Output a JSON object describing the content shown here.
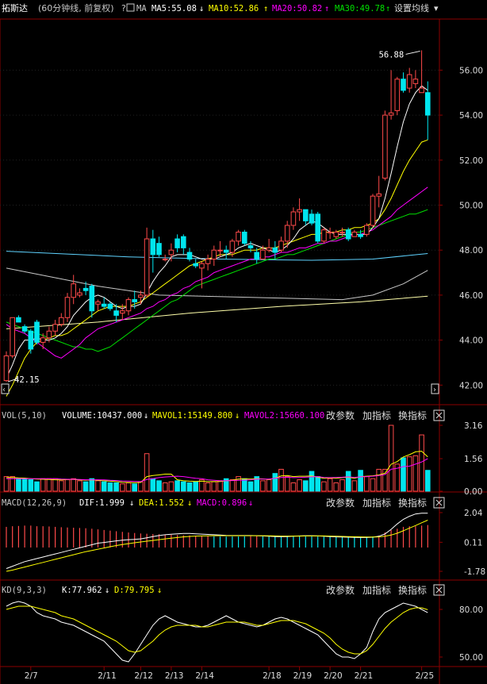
{
  "colors": {
    "up": "#ff4a4a",
    "down": "#00e5ee",
    "frame": "#8b0000",
    "ma5": "#ffffff",
    "ma10": "#ffff00",
    "ma20": "#ff00ff",
    "ma30": "#00e000",
    "extra1": "#5fd3ff",
    "extra2": "#c8c8c8",
    "extra3": "#ffffaa",
    "label": "#c8c8c8",
    "vol": "#ffffff",
    "mavol1": "#ffff00",
    "mavol2": "#ff00ff",
    "dif": "#ffffff",
    "dea": "#ffff00",
    "macd": "#ff00ff",
    "k": "#ffffff",
    "d": "#ffff00"
  },
  "header": {
    "title": "拓斯达",
    "subtitle": "(60分钟线, 前复权)",
    "ma_label": "MA",
    "ma5": "MA5:55.08",
    "ma10": "MA10:52.86",
    "ma20": "MA20:50.82",
    "ma30": "MA30:49.78",
    "settings": "设置均线",
    "arrow_down": "↓",
    "arrow_up": "↑",
    "dropdown": "▾"
  },
  "vol_header": {
    "name": "VOL(5,10)",
    "volume": "VOLUME:10437.000",
    "mavol1": "MAVOL1:15149.800",
    "mavol2": "MAVOL2:15660.100",
    "arrow_down": "↓"
  },
  "macd_header": {
    "name": "MACD(12,26,9)",
    "dif": "DIF:1.999",
    "dea": "DEA:1.552",
    "macd": "MACD:0.896",
    "arrow_down": "↓"
  },
  "kd_header": {
    "name": "KD(9,3,3)",
    "k": "K:77.962",
    "d": "D:79.795",
    "arrow_down": "↓"
  },
  "buttons": {
    "change": "改参数",
    "add": "加指标",
    "swap": "换指标"
  },
  "icons": {
    "close": "close-icon",
    "checkbox": "checkbox-icon",
    "help": "help-icon"
  },
  "chart_data": {
    "type": "candlestick",
    "title": "拓斯达",
    "price_ticks": [
      "56.00",
      "54.00",
      "52.00",
      "50.00",
      "48.00",
      "46.00",
      "44.00",
      "42.00"
    ],
    "price_ylim": [
      41.2,
      58.2
    ],
    "high_label": "56.88",
    "low_label": "42.15",
    "x_labels": [
      "2/7",
      "2/11",
      "2/12",
      "2/13",
      "2/14",
      "2/18",
      "2/19",
      "2/20",
      "2/21",
      "2/25"
    ],
    "candles": [
      {
        "o": 42.2,
        "h": 43.5,
        "l": 42.15,
        "c": 43.3
      },
      {
        "o": 43.3,
        "h": 44.3,
        "l": 43.2,
        "c": 45.0
      },
      {
        "o": 45.0,
        "h": 45.1,
        "l": 44.8,
        "c": 44.8
      },
      {
        "o": 44.6,
        "h": 44.7,
        "l": 44.3,
        "c": 44.4
      },
      {
        "o": 44.4,
        "h": 44.5,
        "l": 43.4,
        "c": 43.6
      },
      {
        "o": 44.8,
        "h": 44.9,
        "l": 43.8,
        "c": 43.9
      },
      {
        "o": 43.9,
        "h": 44.3,
        "l": 43.6,
        "c": 44.1
      },
      {
        "o": 44.1,
        "h": 44.6,
        "l": 43.9,
        "c": 44.4
      },
      {
        "o": 44.4,
        "h": 44.9,
        "l": 44.2,
        "c": 44.7
      },
      {
        "o": 44.7,
        "h": 45.2,
        "l": 44.6,
        "c": 45.0
      },
      {
        "o": 45.0,
        "h": 46.1,
        "l": 44.8,
        "c": 45.9
      },
      {
        "o": 45.9,
        "h": 46.9,
        "l": 45.6,
        "c": 46.5
      },
      {
        "o": 46.0,
        "h": 46.3,
        "l": 45.9,
        "c": 46.1
      },
      {
        "o": 46.3,
        "h": 46.6,
        "l": 46.0,
        "c": 46.2
      },
      {
        "o": 46.4,
        "h": 46.5,
        "l": 45.0,
        "c": 45.3
      },
      {
        "o": 45.6,
        "h": 45.8,
        "l": 45.3,
        "c": 45.7
      },
      {
        "o": 45.6,
        "h": 45.9,
        "l": 45.4,
        "c": 45.5
      },
      {
        "o": 45.6,
        "h": 45.7,
        "l": 45.3,
        "c": 45.4
      },
      {
        "o": 45.3,
        "h": 45.6,
        "l": 44.8,
        "c": 45.1
      },
      {
        "o": 45.2,
        "h": 45.6,
        "l": 44.9,
        "c": 45.3
      },
      {
        "o": 45.3,
        "h": 45.9,
        "l": 45.1,
        "c": 45.8
      },
      {
        "o": 45.8,
        "h": 46.2,
        "l": 45.4,
        "c": 45.7
      },
      {
        "o": 45.9,
        "h": 46.2,
        "l": 45.6,
        "c": 46.0
      },
      {
        "o": 46.0,
        "h": 49.0,
        "l": 45.9,
        "c": 48.5
      },
      {
        "o": 48.5,
        "h": 48.9,
        "l": 47.0,
        "c": 47.8
      },
      {
        "o": 48.3,
        "h": 48.6,
        "l": 47.7,
        "c": 47.8
      },
      {
        "o": 47.6,
        "h": 47.8,
        "l": 47.5,
        "c": 47.6
      },
      {
        "o": 47.8,
        "h": 48.3,
        "l": 47.5,
        "c": 48.0
      },
      {
        "o": 48.5,
        "h": 48.7,
        "l": 47.9,
        "c": 48.1
      },
      {
        "o": 48.6,
        "h": 48.7,
        "l": 47.8,
        "c": 48.1
      },
      {
        "o": 47.9,
        "h": 48.1,
        "l": 47.5,
        "c": 47.6
      },
      {
        "o": 47.4,
        "h": 47.6,
        "l": 47.2,
        "c": 47.3
      },
      {
        "o": 47.2,
        "h": 47.5,
        "l": 46.3,
        "c": 47.4
      },
      {
        "o": 47.4,
        "h": 47.8,
        "l": 47.1,
        "c": 47.6
      },
      {
        "o": 47.6,
        "h": 48.2,
        "l": 47.3,
        "c": 48.0
      },
      {
        "o": 48.0,
        "h": 48.4,
        "l": 47.7,
        "c": 48.0
      },
      {
        "o": 48.0,
        "h": 48.2,
        "l": 47.6,
        "c": 47.9
      },
      {
        "o": 47.9,
        "h": 48.5,
        "l": 47.7,
        "c": 48.4
      },
      {
        "o": 48.4,
        "h": 48.9,
        "l": 48.2,
        "c": 48.8
      },
      {
        "o": 48.8,
        "h": 48.9,
        "l": 48.2,
        "c": 48.3
      },
      {
        "o": 48.2,
        "h": 48.4,
        "l": 47.9,
        "c": 48.1
      },
      {
        "o": 47.9,
        "h": 48.1,
        "l": 47.4,
        "c": 47.6
      },
      {
        "o": 47.6,
        "h": 48.2,
        "l": 47.6,
        "c": 48.0
      },
      {
        "o": 48.0,
        "h": 48.5,
        "l": 47.9,
        "c": 48.1
      },
      {
        "o": 48.1,
        "h": 48.4,
        "l": 47.6,
        "c": 47.9
      },
      {
        "o": 48.0,
        "h": 48.6,
        "l": 47.9,
        "c": 48.4
      },
      {
        "o": 48.4,
        "h": 49.3,
        "l": 48.1,
        "c": 49.1
      },
      {
        "o": 49.1,
        "h": 49.9,
        "l": 48.9,
        "c": 49.7
      },
      {
        "o": 49.7,
        "h": 50.3,
        "l": 49.3,
        "c": 49.8
      },
      {
        "o": 49.8,
        "h": 49.8,
        "l": 49.1,
        "c": 49.3
      },
      {
        "o": 49.6,
        "h": 49.8,
        "l": 49.1,
        "c": 49.2
      },
      {
        "o": 49.6,
        "h": 49.7,
        "l": 48.3,
        "c": 48.4
      },
      {
        "o": 48.4,
        "h": 49.0,
        "l": 48.3,
        "c": 48.9
      },
      {
        "o": 48.8,
        "h": 49.0,
        "l": 48.5,
        "c": 48.8
      },
      {
        "o": 48.6,
        "h": 48.9,
        "l": 48.5,
        "c": 48.8
      },
      {
        "o": 48.8,
        "h": 49.0,
        "l": 48.6,
        "c": 48.8
      },
      {
        "o": 48.9,
        "h": 49.0,
        "l": 48.4,
        "c": 48.5
      },
      {
        "o": 48.6,
        "h": 48.9,
        "l": 48.6,
        "c": 48.8
      },
      {
        "o": 48.7,
        "h": 48.9,
        "l": 48.5,
        "c": 48.6
      },
      {
        "o": 48.7,
        "h": 49.2,
        "l": 48.6,
        "c": 49.1
      },
      {
        "o": 49.1,
        "h": 50.5,
        "l": 49.0,
        "c": 50.4
      },
      {
        "o": 50.4,
        "h": 51.3,
        "l": 49.9,
        "c": 50.5
      },
      {
        "o": 51.2,
        "h": 54.2,
        "l": 51.1,
        "c": 54.0
      },
      {
        "o": 54.0,
        "h": 56.0,
        "l": 53.8,
        "c": 54.1
      },
      {
        "o": 54.2,
        "h": 55.7,
        "l": 54.0,
        "c": 55.6
      },
      {
        "o": 55.6,
        "h": 55.9,
        "l": 55.0,
        "c": 55.1
      },
      {
        "o": 55.2,
        "h": 56.1,
        "l": 55.0,
        "c": 55.8
      },
      {
        "o": 55.4,
        "h": 56.0,
        "l": 55.2,
        "c": 55.6
      },
      {
        "o": 55.0,
        "h": 56.88,
        "l": 55.0,
        "c": 55.2
      },
      {
        "o": 55.0,
        "h": 55.5,
        "l": 52.9,
        "c": 54.0
      }
    ],
    "ma5": [
      42.3,
      42.9,
      43.6,
      44.0,
      44.0,
      44.1,
      44.0,
      44.0,
      44.1,
      44.3,
      44.6,
      45.1,
      45.4,
      45.7,
      45.9,
      46.0,
      45.9,
      45.7,
      45.5,
      45.4,
      45.5,
      45.5,
      45.6,
      46.1,
      46.6,
      47.0,
      47.3,
      47.7,
      47.8,
      47.8,
      47.8,
      47.7,
      47.6,
      47.6,
      47.6,
      47.7,
      47.8,
      47.9,
      48.1,
      48.2,
      48.3,
      48.2,
      48.1,
      48.0,
      47.9,
      48.0,
      48.2,
      48.5,
      48.9,
      49.1,
      49.3,
      49.2,
      49.0,
      48.8,
      48.7,
      48.7,
      48.7,
      48.7,
      48.7,
      48.7,
      49.0,
      49.4,
      50.3,
      51.4,
      52.6,
      53.7,
      54.5,
      55.0,
      55.3,
      55.1
    ],
    "ma10": [
      41.5,
      42.0,
      42.6,
      43.2,
      43.6,
      43.9,
      44.0,
      44.1,
      44.2,
      44.2,
      44.3,
      44.5,
      44.7,
      44.9,
      45.1,
      45.3,
      45.4,
      45.5,
      45.5,
      45.5,
      45.5,
      45.6,
      45.7,
      45.9,
      46.1,
      46.3,
      46.5,
      46.7,
      46.9,
      47.1,
      47.3,
      47.4,
      47.5,
      47.6,
      47.7,
      47.8,
      47.8,
      47.8,
      47.9,
      48.0,
      48.0,
      48.0,
      48.1,
      48.1,
      48.1,
      48.2,
      48.3,
      48.4,
      48.5,
      48.6,
      48.7,
      48.7,
      48.8,
      48.8,
      48.8,
      48.9,
      48.9,
      49.0,
      49.0,
      49.1,
      49.2,
      49.4,
      49.8,
      50.3,
      50.9,
      51.5,
      52.0,
      52.4,
      52.8,
      52.9
    ],
    "ma20": [
      44.7,
      44.5,
      44.4,
      44.3,
      44.1,
      43.9,
      43.7,
      43.5,
      43.3,
      43.2,
      43.4,
      43.6,
      43.8,
      44.1,
      44.3,
      44.5,
      44.6,
      44.7,
      44.8,
      44.9,
      45.0,
      45.1,
      45.2,
      45.4,
      45.5,
      45.7,
      45.8,
      46.0,
      46.1,
      46.3,
      46.4,
      46.6,
      46.7,
      46.8,
      47.0,
      47.1,
      47.2,
      47.3,
      47.4,
      47.5,
      47.6,
      47.6,
      47.7,
      47.7,
      47.8,
      47.9,
      47.9,
      48.0,
      48.1,
      48.1,
      48.2,
      48.3,
      48.3,
      48.4,
      48.4,
      48.5,
      48.6,
      48.7,
      48.7,
      48.8,
      48.9,
      49.1,
      49.3,
      49.5,
      49.8,
      50.0,
      50.2,
      50.4,
      50.6,
      50.8
    ],
    "ma30": [
      44.8,
      44.7,
      44.6,
      44.5,
      44.4,
      44.3,
      44.2,
      44.1,
      44.0,
      43.9,
      43.8,
      43.7,
      43.7,
      43.6,
      43.6,
      43.5,
      43.6,
      43.7,
      43.9,
      44.1,
      44.3,
      44.5,
      44.7,
      44.9,
      45.1,
      45.3,
      45.5,
      45.7,
      45.8,
      46.0,
      46.2,
      46.4,
      46.5,
      46.6,
      46.7,
      46.8,
      46.9,
      47.0,
      47.1,
      47.2,
      47.3,
      47.4,
      47.5,
      47.6,
      47.6,
      47.7,
      47.8,
      47.8,
      47.9,
      48.0,
      48.1,
      48.2,
      48.3,
      48.4,
      48.5,
      48.6,
      48.7,
      48.8,
      48.8,
      48.9,
      49.0,
      49.1,
      49.2,
      49.3,
      49.4,
      49.5,
      49.6,
      49.6,
      49.7,
      49.8
    ],
    "ma60_line": {
      "points": [
        [
          0,
          47.95
        ],
        [
          20,
          47.7
        ],
        [
          35,
          47.6
        ],
        [
          50,
          47.55
        ],
        [
          60,
          47.6
        ],
        [
          69,
          47.85
        ]
      ]
    },
    "ma120_line": {
      "points": [
        [
          0,
          47.2
        ],
        [
          15,
          46.4
        ],
        [
          25,
          46.0
        ],
        [
          40,
          45.9
        ],
        [
          55,
          45.8
        ],
        [
          60,
          46.0
        ],
        [
          65,
          46.5
        ],
        [
          69,
          47.1
        ]
      ]
    },
    "ma250_line": {
      "points": [
        [
          0,
          44.5
        ],
        [
          15,
          44.8
        ],
        [
          30,
          45.2
        ],
        [
          45,
          45.5
        ],
        [
          58,
          45.7
        ],
        [
          69,
          45.95
        ]
      ]
    },
    "vol_ticks": [
      "3.16",
      "1.56",
      "0.00"
    ],
    "vol_ylim": [
      0,
      3.16
    ],
    "volumes": [
      0.7,
      0.7,
      0.6,
      0.6,
      0.55,
      0.45,
      0.6,
      0.6,
      0.6,
      0.5,
      0.55,
      0.6,
      0.5,
      0.45,
      0.6,
      0.5,
      0.45,
      0.4,
      0.4,
      0.35,
      0.4,
      0.35,
      0.45,
      1.8,
      0.6,
      0.5,
      0.4,
      0.45,
      0.5,
      0.45,
      0.4,
      0.45,
      0.55,
      0.4,
      0.45,
      0.5,
      0.6,
      0.55,
      0.7,
      0.6,
      0.45,
      0.7,
      0.5,
      0.55,
      0.85,
      1.05,
      0.7,
      0.4,
      0.55,
      0.5,
      0.95,
      0.7,
      0.45,
      0.6,
      0.4,
      0.55,
      0.95,
      0.5,
      1.0,
      0.7,
      0.6,
      1.05,
      1.05,
      3.16,
      1.3,
      1.6,
      1.65,
      1.7,
      2.7,
      1.0
    ],
    "mavol1": [
      0.65,
      0.66,
      0.64,
      0.63,
      0.6,
      0.58,
      0.57,
      0.56,
      0.55,
      0.54,
      0.56,
      0.56,
      0.54,
      0.53,
      0.54,
      0.52,
      0.5,
      0.48,
      0.46,
      0.43,
      0.42,
      0.41,
      0.42,
      0.7,
      0.75,
      0.78,
      0.82,
      0.82,
      0.55,
      0.5,
      0.48,
      0.47,
      0.48,
      0.46,
      0.46,
      0.46,
      0.5,
      0.52,
      0.58,
      0.59,
      0.58,
      0.6,
      0.59,
      0.56,
      0.62,
      0.73,
      0.75,
      0.7,
      0.72,
      0.72,
      0.73,
      0.67,
      0.62,
      0.64,
      0.62,
      0.65,
      0.67,
      0.62,
      0.7,
      0.72,
      0.74,
      0.78,
      0.86,
      1.29,
      1.42,
      1.64,
      1.75,
      1.89,
      1.92,
      1.65
    ],
    "mavol2": [
      0.6,
      0.6,
      0.6,
      0.6,
      0.6,
      0.6,
      0.6,
      0.6,
      0.6,
      0.58,
      0.57,
      0.57,
      0.56,
      0.55,
      0.55,
      0.55,
      0.54,
      0.52,
      0.51,
      0.49,
      0.48,
      0.47,
      0.46,
      0.56,
      0.6,
      0.65,
      0.68,
      0.7,
      0.72,
      0.7,
      0.66,
      0.62,
      0.6,
      0.55,
      0.52,
      0.5,
      0.5,
      0.51,
      0.52,
      0.53,
      0.55,
      0.58,
      0.58,
      0.58,
      0.62,
      0.66,
      0.67,
      0.65,
      0.66,
      0.67,
      0.69,
      0.7,
      0.66,
      0.65,
      0.66,
      0.67,
      0.69,
      0.66,
      0.69,
      0.7,
      0.72,
      0.75,
      0.8,
      1.05,
      1.1,
      1.18,
      1.2,
      1.3,
      1.4,
      1.56
    ],
    "macd_ticks": [
      "2.04",
      "0.11",
      "-1.78"
    ],
    "macd_ylim": [
      -1.78,
      2.04
    ],
    "dif": [
      -1.6,
      -1.45,
      -1.3,
      -1.15,
      -1.05,
      -0.95,
      -0.85,
      -0.75,
      -0.65,
      -0.55,
      -0.45,
      -0.35,
      -0.25,
      -0.15,
      -0.05,
      0.05,
      0.1,
      0.15,
      0.2,
      0.25,
      0.28,
      0.3,
      0.33,
      0.4,
      0.48,
      0.55,
      0.6,
      0.63,
      0.66,
      0.68,
      0.68,
      0.66,
      0.64,
      0.62,
      0.6,
      0.58,
      0.56,
      0.55,
      0.55,
      0.55,
      0.55,
      0.54,
      0.52,
      0.5,
      0.48,
      0.47,
      0.48,
      0.5,
      0.52,
      0.54,
      0.54,
      0.52,
      0.5,
      0.48,
      0.46,
      0.45,
      0.44,
      0.43,
      0.42,
      0.42,
      0.44,
      0.5,
      0.65,
      0.95,
      1.3,
      1.6,
      1.8,
      1.95,
      2.0,
      1.999
    ],
    "dea": [
      -1.78,
      -1.7,
      -1.6,
      -1.5,
      -1.4,
      -1.3,
      -1.2,
      -1.1,
      -1.0,
      -0.9,
      -0.8,
      -0.7,
      -0.6,
      -0.5,
      -0.42,
      -0.34,
      -0.26,
      -0.18,
      -0.1,
      -0.04,
      0.02,
      0.08,
      0.13,
      0.18,
      0.23,
      0.28,
      0.33,
      0.38,
      0.42,
      0.46,
      0.49,
      0.51,
      0.52,
      0.53,
      0.54,
      0.54,
      0.54,
      0.54,
      0.54,
      0.54,
      0.54,
      0.54,
      0.54,
      0.53,
      0.52,
      0.51,
      0.51,
      0.51,
      0.51,
      0.52,
      0.52,
      0.52,
      0.52,
      0.51,
      0.5,
      0.49,
      0.48,
      0.47,
      0.46,
      0.45,
      0.45,
      0.46,
      0.5,
      0.58,
      0.7,
      0.86,
      1.03,
      1.2,
      1.38,
      1.552
    ],
    "macd_bars": [
      0.75,
      0.8,
      0.82,
      0.85,
      0.85,
      0.8,
      0.8,
      0.78,
      0.75,
      0.72,
      0.7,
      0.68,
      0.66,
      0.64,
      0.6,
      0.55,
      0.5,
      0.45,
      0.4,
      0.35,
      0.3,
      0.26,
      0.22,
      0.2,
      0.18,
      0.16,
      0.14,
      0.12,
      0.1,
      0.08,
      0.06,
      0.04,
      0.02,
      0.0,
      -0.01,
      -0.02,
      -0.03,
      -0.02,
      -0.02,
      -0.01,
      0.0,
      0.0,
      -0.02,
      -0.02,
      -0.03,
      -0.04,
      -0.04,
      -0.03,
      -0.02,
      -0.02,
      -0.02,
      -0.03,
      -0.04,
      -0.05,
      -0.06,
      -0.06,
      -0.06,
      -0.06,
      -0.05,
      -0.04,
      -0.02,
      0.05,
      0.3,
      0.5,
      0.6,
      0.75,
      0.8,
      0.8,
      0.85,
      0.896
    ],
    "kd_ticks": [
      "80.00",
      "50.00"
    ],
    "kd_ylim": [
      45,
      88
    ],
    "k": [
      82,
      84,
      85,
      84,
      82,
      78,
      76,
      75,
      74,
      72,
      71,
      70,
      68,
      66,
      64,
      62,
      60,
      56,
      52,
      48,
      47,
      52,
      58,
      64,
      70,
      74,
      76,
      74,
      72,
      71,
      70,
      69,
      69,
      70,
      72,
      74,
      76,
      74,
      72,
      71,
      70,
      69,
      70,
      72,
      74,
      75,
      74,
      72,
      70,
      68,
      66,
      64,
      60,
      56,
      52,
      50,
      50,
      49,
      52,
      56,
      66,
      74,
      78,
      80,
      82,
      84,
      83,
      82,
      80,
      77.962
    ],
    "d": [
      80,
      81,
      82,
      82,
      82,
      81,
      80,
      79,
      78,
      76,
      75,
      74,
      72,
      70,
      68,
      66,
      64,
      62,
      60,
      57,
      54,
      53,
      54,
      57,
      60,
      64,
      67,
      69,
      70,
      70,
      70,
      70,
      69,
      69,
      70,
      71,
      72,
      72,
      72,
      72,
      71,
      70,
      70,
      71,
      72,
      73,
      73,
      73,
      72,
      71,
      69,
      67,
      65,
      62,
      58,
      55,
      53,
      52,
      52,
      54,
      58,
      63,
      68,
      72,
      75,
      78,
      80,
      81,
      81,
      79.795
    ]
  }
}
